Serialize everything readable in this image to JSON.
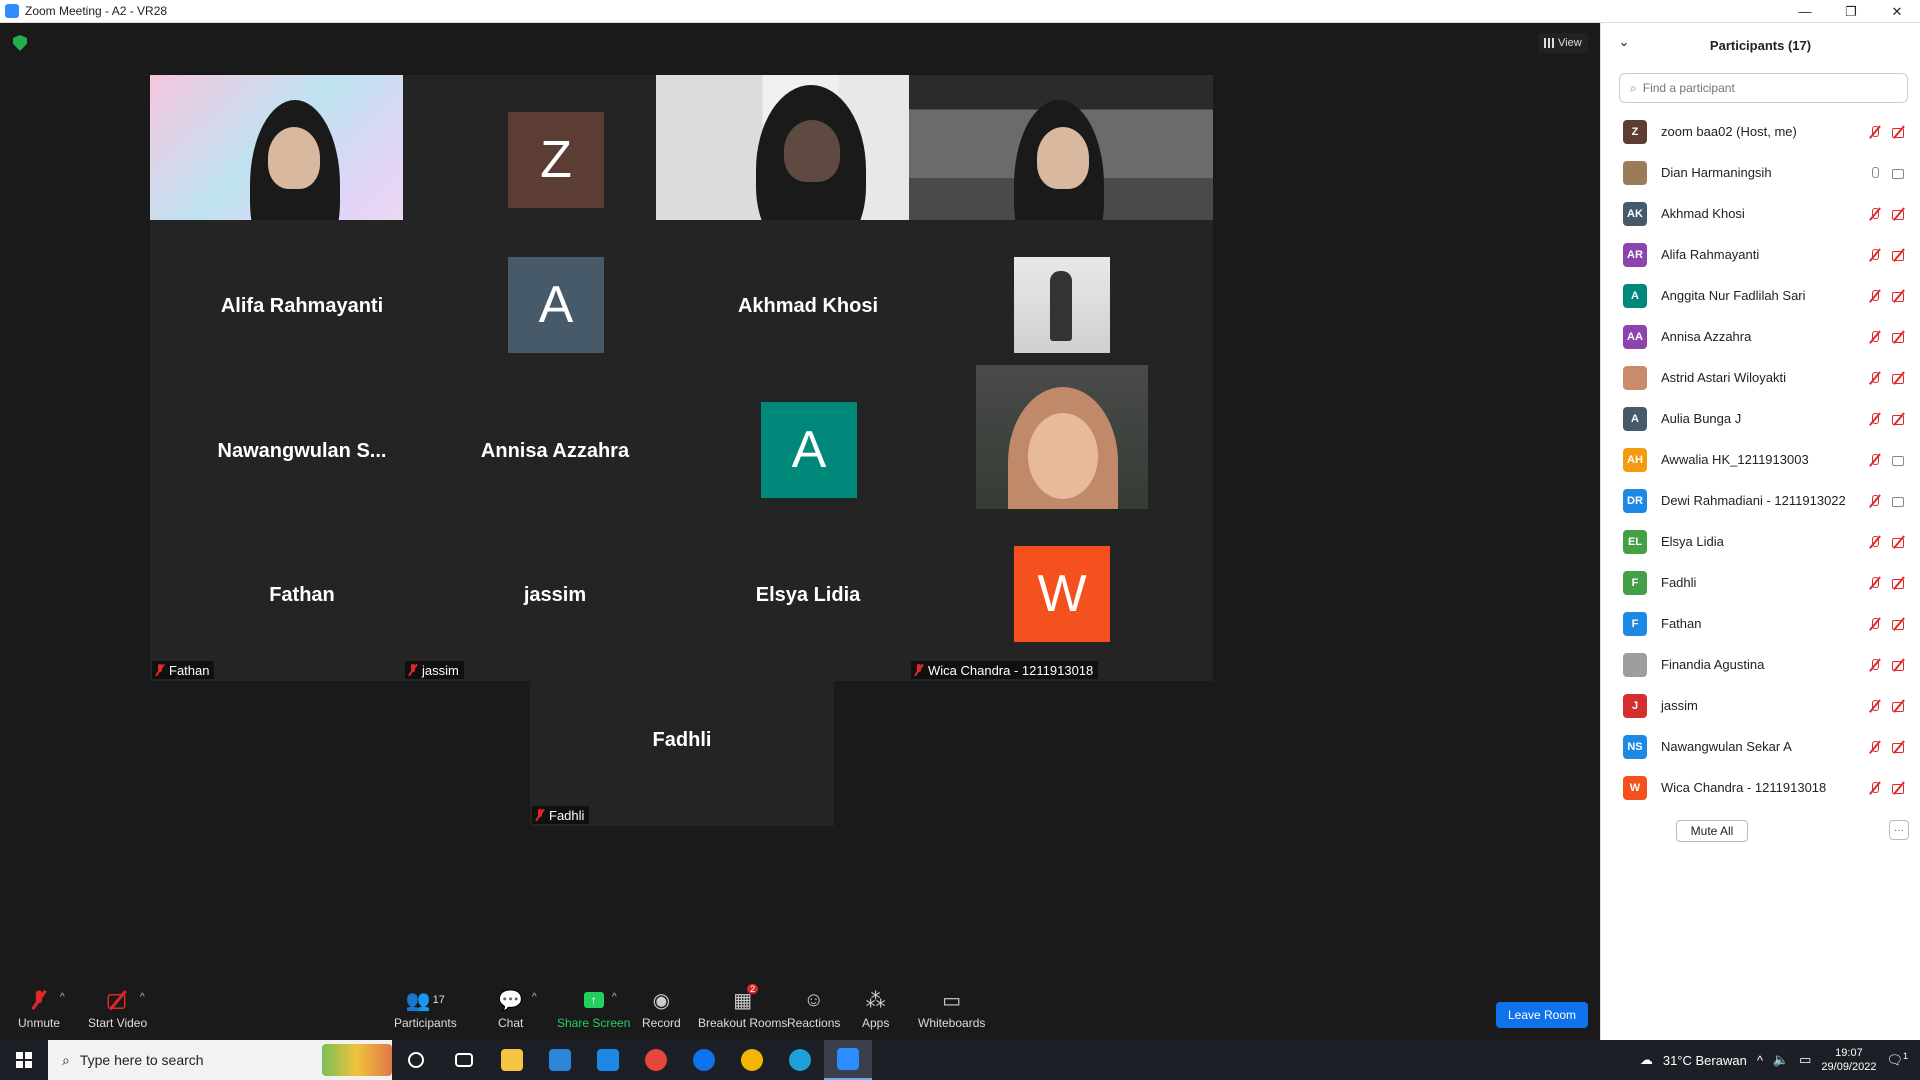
{
  "window": {
    "title": "Zoom Meeting - A2 - VR28",
    "minimize": "—",
    "restore": "❐",
    "close": "✕"
  },
  "view_button": "View",
  "tiles": [
    {
      "name": "Dewi Rahmadiani - 1211913022",
      "kind": "video"
    },
    {
      "name": "zoom baa02",
      "kind": "avatar",
      "avatar_letter": "Z",
      "avatar_color": "#5c3d33"
    },
    {
      "name": "Dian Harmaningsih",
      "kind": "video"
    },
    {
      "name": "Awwalia HK_1211913003",
      "kind": "video"
    },
    {
      "name": "Alifa Rahmayanti",
      "kind": "name",
      "display": "Alifa Rahmayanti"
    },
    {
      "name": "Aulia Bunga J",
      "kind": "avatar",
      "avatar_letter": "A",
      "avatar_color": "#465a69"
    },
    {
      "name": "Akhmad Khosi",
      "kind": "name",
      "display": "Akhmad Khosi"
    },
    {
      "name": "Finandia Agustina",
      "kind": "photo"
    },
    {
      "name": "Nawangwulan Sekar A",
      "kind": "name",
      "display": "Nawangwulan  S..."
    },
    {
      "name": "Annisa Azzahra",
      "kind": "name",
      "display": "Annisa Azzahra"
    },
    {
      "name": "Anggita Nur Fadlilah Sari",
      "kind": "avatar",
      "avatar_letter": "A",
      "avatar_color": "#00897b"
    },
    {
      "name": "Astrid Astari Wiloyakti",
      "kind": "photo"
    },
    {
      "name": "Fathan",
      "kind": "name",
      "display": "Fathan"
    },
    {
      "name": "jassim",
      "kind": "name",
      "display": "jassim"
    },
    {
      "name": "Elsya Lidia",
      "kind": "name",
      "display": "Elsya Lidia"
    },
    {
      "name": "Wica Chandra - 1211913018",
      "kind": "avatar",
      "avatar_letter": "W",
      "avatar_color": "#f4511e"
    },
    {
      "name": "Fadhli",
      "kind": "name",
      "display": "Fadhli"
    }
  ],
  "toolbar": {
    "unmute": "Unmute",
    "start_video": "Start Video",
    "participants": "Participants",
    "participants_count": "17",
    "chat": "Chat",
    "share_screen": "Share Screen",
    "record": "Record",
    "breakout_rooms": "Breakout Rooms",
    "breakout_badge": "2",
    "reactions": "Reactions",
    "apps": "Apps",
    "whiteboards": "Whiteboards",
    "leave": "Leave Room"
  },
  "panel": {
    "title": "Participants (17)",
    "search_placeholder": "Find a participant",
    "mute_all": "Mute All",
    "more": "···",
    "participants": [
      {
        "name": "zoom baa02 (Host, me)",
        "initials": "Z",
        "color": "#5c3d33",
        "mic": "off",
        "cam": "off"
      },
      {
        "name": "Dian Harmaningsih",
        "initials": "",
        "color": "#9a7b5a",
        "mic": "on",
        "cam": "on"
      },
      {
        "name": "Akhmad Khosi",
        "initials": "AK",
        "color": "#465a69",
        "mic": "off",
        "cam": "off"
      },
      {
        "name": "Alifa Rahmayanti",
        "initials": "AR",
        "color": "#8e44ad",
        "mic": "off",
        "cam": "off"
      },
      {
        "name": "Anggita Nur Fadlilah Sari",
        "initials": "A",
        "color": "#00897b",
        "mic": "off",
        "cam": "off"
      },
      {
        "name": "Annisa Azzahra",
        "initials": "AA",
        "color": "#8e44ad",
        "mic": "off",
        "cam": "off"
      },
      {
        "name": "Astrid Astari Wiloyakti",
        "initials": "",
        "color": "#c98b6b",
        "mic": "off",
        "cam": "off"
      },
      {
        "name": "Aulia Bunga J",
        "initials": "A",
        "color": "#465a69",
        "mic": "off",
        "cam": "off"
      },
      {
        "name": "Awwalia HK_1211913003",
        "initials": "AH",
        "color": "#f39c12",
        "mic": "off",
        "cam": "on"
      },
      {
        "name": "Dewi Rahmadiani - 1211913022",
        "initials": "DR",
        "color": "#1e88e5",
        "mic": "off",
        "cam": "on"
      },
      {
        "name": "Elsya Lidia",
        "initials": "EL",
        "color": "#43a047",
        "mic": "off",
        "cam": "off"
      },
      {
        "name": "Fadhli",
        "initials": "F",
        "color": "#43a047",
        "mic": "off",
        "cam": "off"
      },
      {
        "name": "Fathan",
        "initials": "F",
        "color": "#1e88e5",
        "mic": "off",
        "cam": "off"
      },
      {
        "name": "Finandia Agustina",
        "initials": "",
        "color": "#9e9e9e",
        "mic": "off",
        "cam": "off"
      },
      {
        "name": "jassim",
        "initials": "J",
        "color": "#d32f2f",
        "mic": "off",
        "cam": "off"
      },
      {
        "name": "Nawangwulan Sekar A",
        "initials": "NS",
        "color": "#1e88e5",
        "mic": "off",
        "cam": "off"
      },
      {
        "name": "Wica Chandra - 1211913018",
        "initials": "W",
        "color": "#f4511e",
        "mic": "off",
        "cam": "off"
      }
    ]
  },
  "taskbar": {
    "search_placeholder": "Type here to search",
    "weather": "31°C  Berawan",
    "time": "19:07",
    "date": "29/09/2022",
    "notif_count": "1",
    "apps": [
      {
        "name": "cortana",
        "color": "#ffffff"
      },
      {
        "name": "task-view",
        "color": "#ffffff"
      },
      {
        "name": "file-explorer",
        "color": "#f6c445"
      },
      {
        "name": "store",
        "color": "#2b88d8"
      },
      {
        "name": "mail",
        "color": "#1e88e5"
      },
      {
        "name": "chrome",
        "color": "#e5463a"
      },
      {
        "name": "teamviewer",
        "color": "#0e72ed"
      },
      {
        "name": "chrome-profile",
        "color": "#f4b400"
      },
      {
        "name": "edge",
        "color": "#1fa0d8"
      },
      {
        "name": "zoom",
        "color": "#2d8cff"
      }
    ]
  }
}
